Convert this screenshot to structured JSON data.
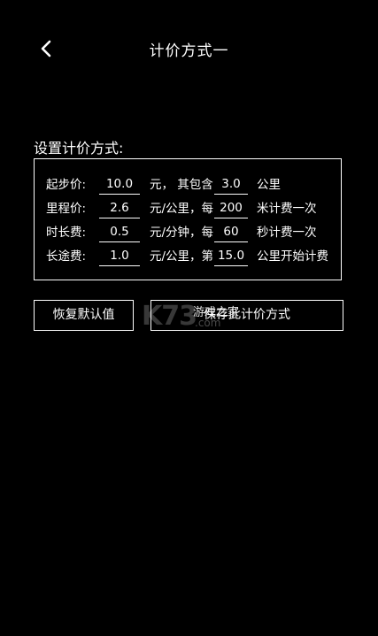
{
  "header": {
    "title": "计价方式一",
    "back_icon": "chevron-left-icon"
  },
  "section_label": "设置计价方式:",
  "pricing": {
    "rows": [
      {
        "label": "起步价:",
        "value1": "10.0",
        "unit1": "元，  其包含",
        "value2": "3.0",
        "unit2": "公里"
      },
      {
        "label": "里程价:",
        "value1": "2.6",
        "unit1": "元/公里，每",
        "value2": "200",
        "unit2": "米计费一次"
      },
      {
        "label": "时长费:",
        "value1": "0.5",
        "unit1": "元/分钟，每",
        "value2": "60",
        "unit2": "秒计费一次"
      },
      {
        "label": "长途费:",
        "value1": "1.0",
        "unit1": "元/公里，第",
        "value2": "15.0",
        "unit2": "公里开始计费"
      }
    ]
  },
  "buttons": {
    "reset_label": "恢复默认值",
    "save_label": "保存此计价方式"
  },
  "watermark": {
    "logo": "K73",
    "domain": ".com",
    "text": "游戏之家"
  }
}
